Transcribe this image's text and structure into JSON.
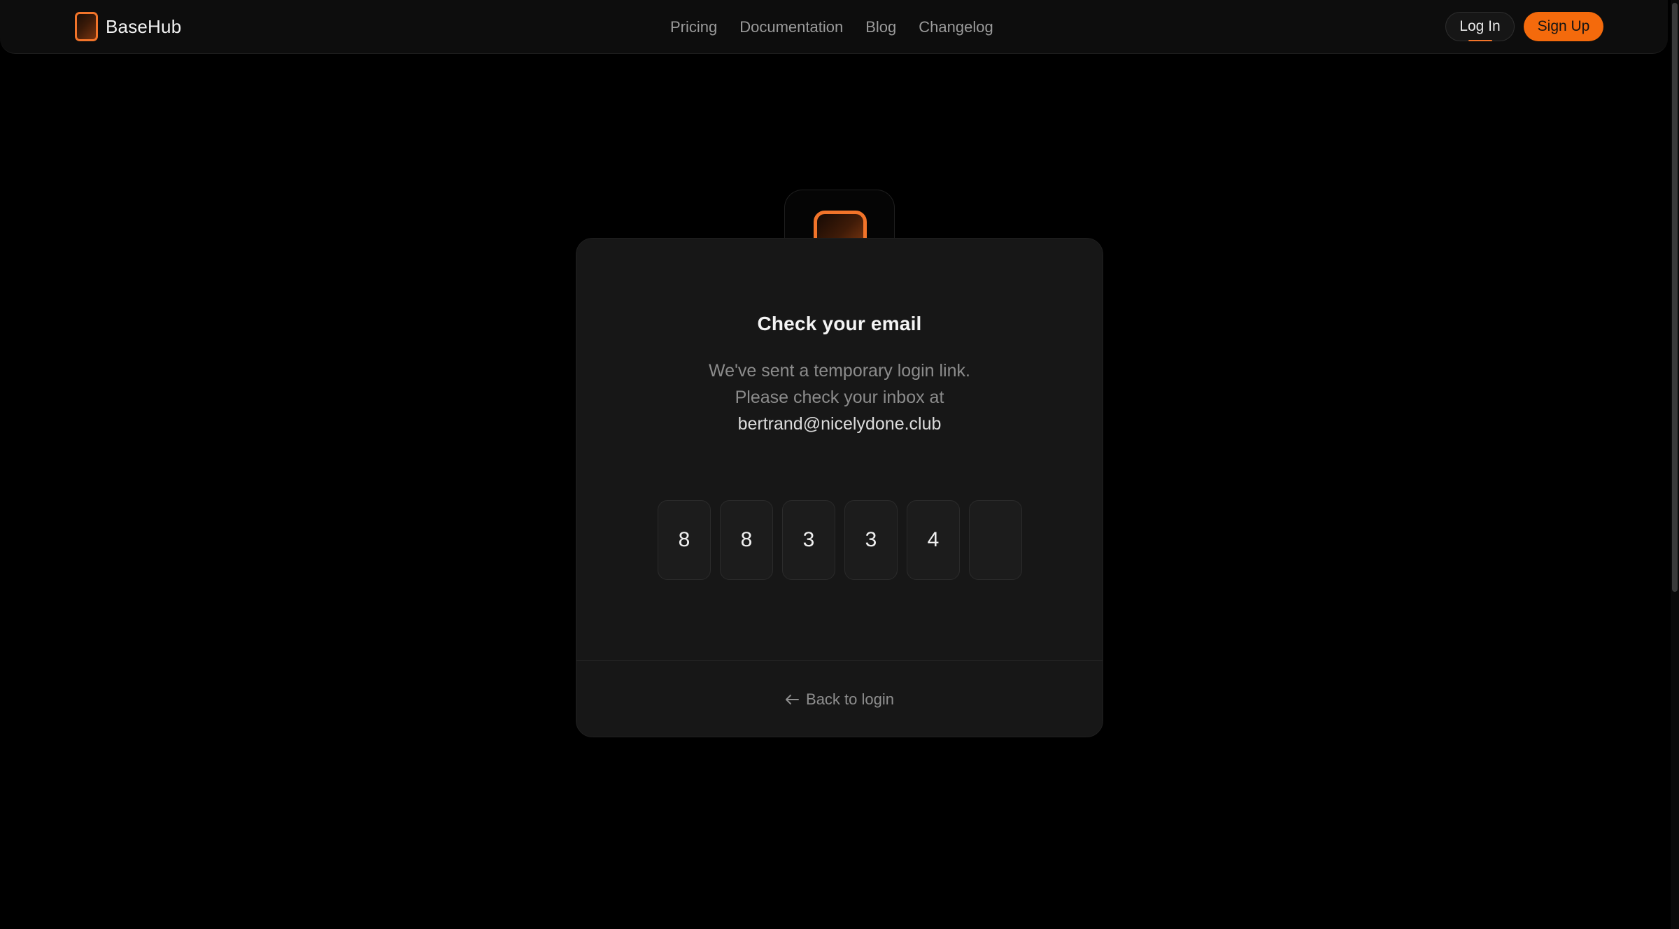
{
  "header": {
    "brand_name": "BaseHub",
    "nav": [
      {
        "label": "Pricing"
      },
      {
        "label": "Documentation"
      },
      {
        "label": "Blog"
      },
      {
        "label": "Changelog"
      }
    ],
    "login_label": "Log In",
    "signup_label": "Sign Up"
  },
  "card": {
    "title": "Check your email",
    "description_line1": "We've sent a temporary login link.",
    "description_line2": "Please check your inbox at",
    "email": "bertrand@nicelydone.club",
    "otp_digits": [
      "8",
      "8",
      "3",
      "3",
      "4",
      ""
    ],
    "back_label": "Back to login"
  },
  "icons": {
    "back": "arrow-left-icon",
    "logo": "basehub-logo-icon"
  },
  "colors": {
    "accent": "#f46a0c",
    "background": "#000000",
    "card": "#171717"
  }
}
